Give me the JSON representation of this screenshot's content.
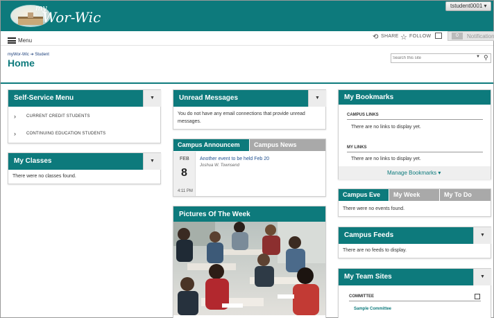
{
  "header": {
    "logo_small": "my",
    "logo_text": "Wor-Wic",
    "user": "tstudent0001 ▾"
  },
  "toolbar": {
    "menu_label": "Menu",
    "share_label": "SHARE",
    "follow_label": "FOLLOW",
    "notif_count": "0",
    "notif_label": "Notification"
  },
  "breadcrumb": {
    "home": "myWor-Wic",
    "arrow": "➔",
    "current": "Student"
  },
  "page_title": "Home",
  "search": {
    "placeholder": "Search this site"
  },
  "self_service": {
    "title": "Self-Service Menu",
    "items": [
      "CURRENT CREDIT STUDENTS",
      "CONTINUING EDUCATION STUDENTS"
    ]
  },
  "my_classes": {
    "title": "My Classes",
    "empty": "There were no classes found."
  },
  "unread": {
    "title": "Unread Messages",
    "line1": "You do not have any email connections that provide unread",
    "line2": "messages."
  },
  "announcements": {
    "tab_active": "Campus Announcem",
    "tab_inactive": "Campus News",
    "month": "FEB",
    "day": "8",
    "time": "4:11 PM",
    "headline": "Another event to be held Feb 20",
    "author": "Joshua W. Townsend"
  },
  "pictures": {
    "title": "Pictures Of The Week"
  },
  "bookmarks": {
    "title": "My Bookmarks",
    "campus_links": "CAMPUS LINKS",
    "campus_empty": "There are no links to display yet.",
    "my_links": "MY LINKS",
    "my_empty": "There are no links to display yet.",
    "manage": "Manage Bookmarks ▾"
  },
  "events": {
    "tabs": [
      "Campus Eve",
      "My Week",
      "My To Do"
    ],
    "empty": "There were no events found."
  },
  "feeds": {
    "title": "Campus Feeds",
    "empty": "There are no feeds to display."
  },
  "team_sites": {
    "title": "My Team Sites",
    "section": "COMMITTEE",
    "link": "Sample Committee"
  },
  "colors": {
    "accent": "#0d7a7c",
    "tab_inactive": "#a9a9a9"
  }
}
